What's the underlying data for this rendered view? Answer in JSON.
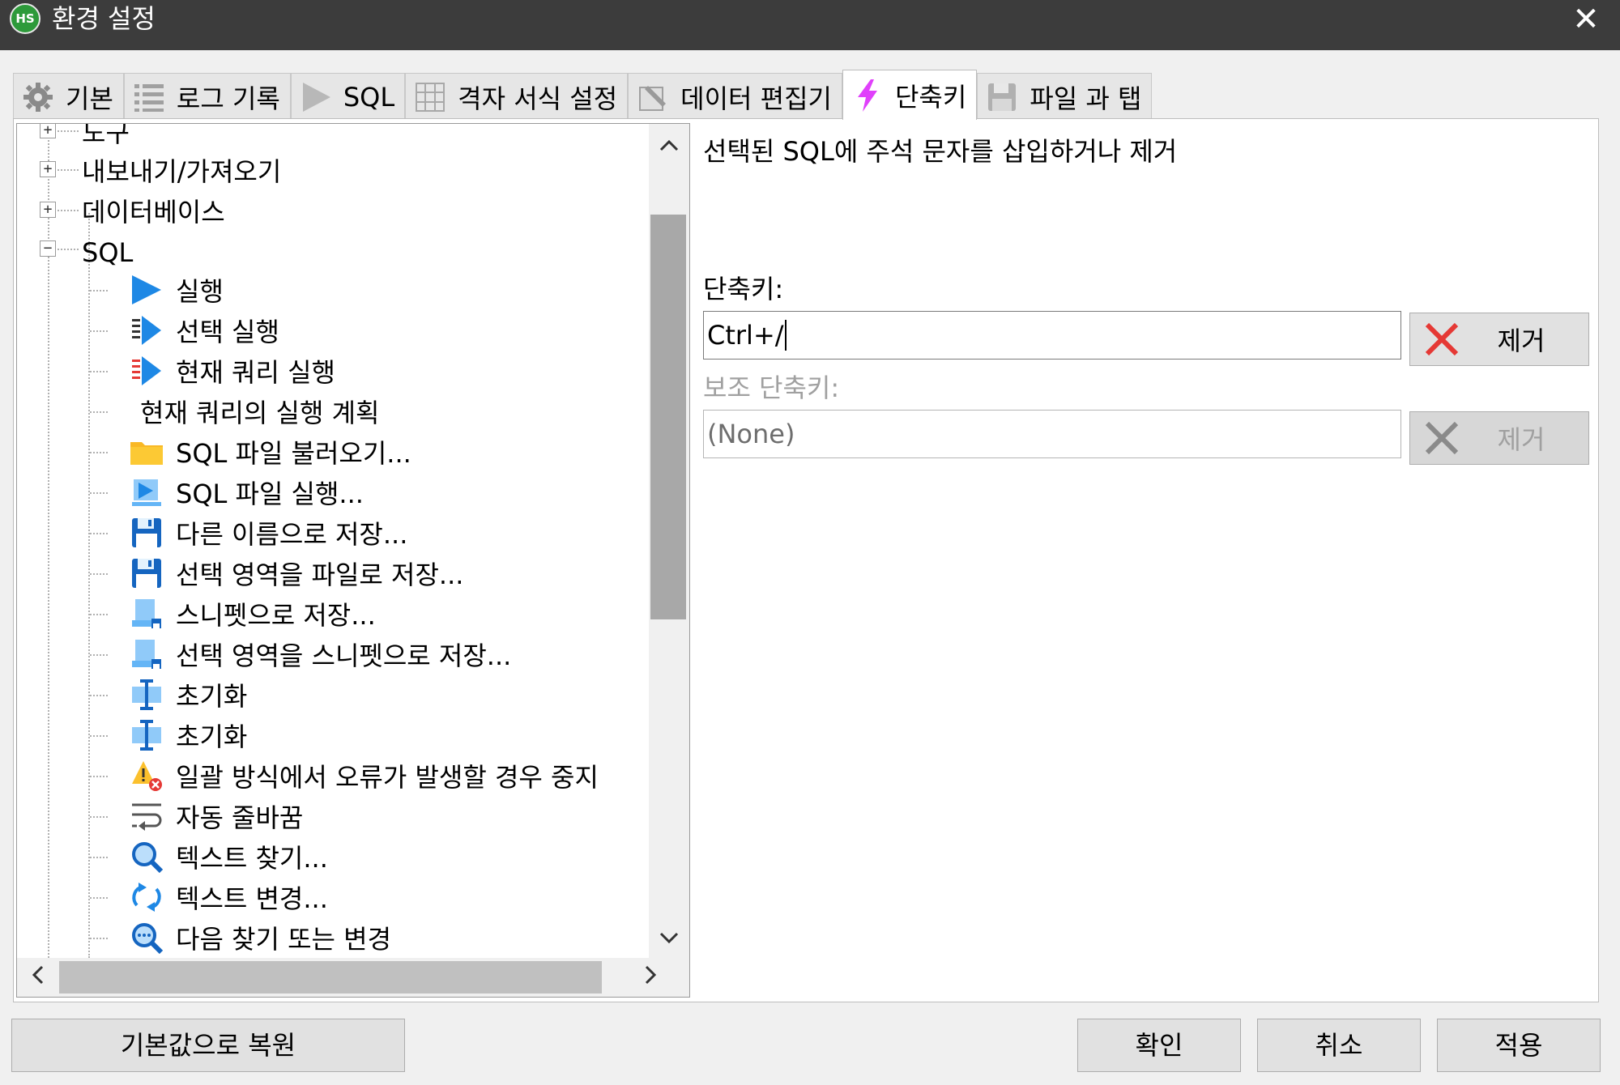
{
  "window": {
    "logo_text": "HS",
    "title": "환경 설정",
    "close_glyph": "✕"
  },
  "tabs": [
    {
      "label": "기본",
      "icon": "gear-icon"
    },
    {
      "label": "로그 기록",
      "icon": "list-icon"
    },
    {
      "label": "SQL",
      "icon": "play-icon"
    },
    {
      "label": "격자 서식 설정",
      "icon": "grid-icon"
    },
    {
      "label": "데이터 편집기",
      "icon": "edit-icon"
    },
    {
      "label": "단축키",
      "icon": "lightning-icon",
      "active": true
    },
    {
      "label": "파일 과 탭",
      "icon": "floppy-icon"
    }
  ],
  "tree": {
    "items": [
      {
        "label": "도구",
        "expander": "+"
      },
      {
        "label": "내보내기/가져오기",
        "expander": "+"
      },
      {
        "label": "데이터베이스",
        "expander": "+"
      },
      {
        "label": "SQL",
        "expander": "−"
      },
      {
        "label": "실행",
        "icon": "play-icon"
      },
      {
        "label": "선택 실행",
        "icon": "run-selection-icon"
      },
      {
        "label": "현재 쿼리 실행",
        "icon": "run-current-query-icon"
      },
      {
        "label": "현재 쿼리의 실행 계획",
        "icon": ""
      },
      {
        "label": "SQL 파일 불러오기...",
        "icon": "folder-icon"
      },
      {
        "label": "SQL 파일 실행...",
        "icon": "run-file-icon"
      },
      {
        "label": "다른 이름으로 저장...",
        "icon": "save-icon"
      },
      {
        "label": "선택 영역을 파일로 저장...",
        "icon": "save-icon"
      },
      {
        "label": "스니펫으로 저장...",
        "icon": "snippet-icon"
      },
      {
        "label": "선택 영역을 스니펫으로 저장...",
        "icon": "snippet-icon"
      },
      {
        "label": "초기화",
        "icon": "text-cursor-icon"
      },
      {
        "label": "초기화",
        "icon": "text-cursor-icon"
      },
      {
        "label": "일괄 방식에서 오류가 발생할 경우 중지",
        "icon": "warning-icon"
      },
      {
        "label": "자동 줄바꿈",
        "icon": "word-wrap-icon"
      },
      {
        "label": "텍스트 찾기...",
        "icon": "search-icon"
      },
      {
        "label": "텍스트 변경...",
        "icon": "replace-icon"
      },
      {
        "label": "다음 찾기 또는 변경",
        "icon": "find-next-icon"
      }
    ]
  },
  "details": {
    "description": "선택된 SQL에 주석 문자를 삽입하거나 제거",
    "shortcut_label": "단축키:",
    "shortcut_value": "Ctrl+/",
    "secondary_label": "보조 단축키:",
    "secondary_value": "(None)",
    "remove_label": "제거"
  },
  "buttons": {
    "restore_defaults": "기본값으로 복원",
    "ok": "확인",
    "cancel": "취소",
    "apply": "적용"
  },
  "colors": {
    "titlebar": "#3c3c3c",
    "accent_blue": "#1e88e5",
    "lightning": "#e040fb",
    "remove_red": "#e53935"
  }
}
